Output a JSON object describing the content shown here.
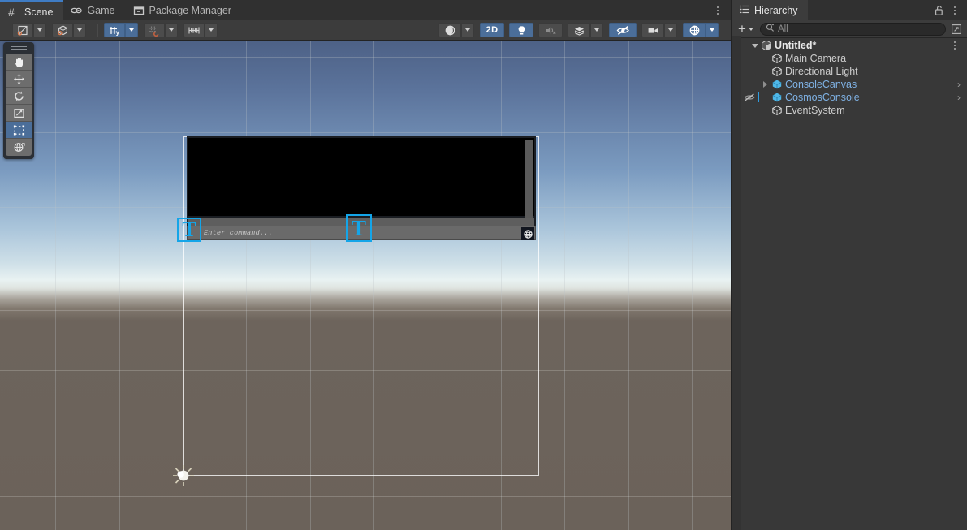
{
  "window": {
    "tabs": [
      {
        "label": "Scene",
        "icon": "grid-hash-icon",
        "active": true
      },
      {
        "label": "Game",
        "icon": "gamepad-icon",
        "active": false
      },
      {
        "label": "Package Manager",
        "icon": "package-icon",
        "active": false
      }
    ],
    "overflow_menu": "more-options"
  },
  "scene_toolbar": {
    "left": [
      {
        "name": "pivot-mode-toggle",
        "icon": "pivot-center-icon",
        "state": "normal"
      },
      {
        "name": "pivot-mode-dropdown",
        "icon": "chevron-down-icon",
        "state": "normal"
      },
      {
        "name": "handle-space-toggle",
        "icon": "cube-global-icon",
        "state": "normal"
      },
      {
        "name": "handle-space-dropdown",
        "icon": "chevron-down-icon",
        "state": "normal"
      },
      {
        "name": "grid-snapping-toggle",
        "icon": "grid-snap-icon",
        "state": "active"
      },
      {
        "name": "grid-snapping-dropdown",
        "icon": "chevron-down-icon",
        "state": "active"
      },
      {
        "name": "grid-visibility-toggle",
        "icon": "grid-magnet-icon",
        "state": "disabled"
      },
      {
        "name": "grid-visibility-dropdown",
        "icon": "chevron-down-icon",
        "state": "disabled"
      },
      {
        "name": "snap-increment-toggle",
        "icon": "ruler-icon",
        "state": "normal"
      },
      {
        "name": "snap-increment-dropdown",
        "icon": "chevron-down-icon",
        "state": "normal"
      }
    ],
    "right": [
      {
        "name": "draw-mode-dropdown",
        "icon": "shaded-sphere-icon",
        "label": "",
        "state": "normal"
      },
      {
        "name": "draw-mode-chevron",
        "icon": "chevron-down-icon",
        "state": "normal"
      },
      {
        "name": "2d-toggle",
        "icon": "",
        "label": "2D",
        "state": "active"
      },
      {
        "name": "scene-lighting-toggle",
        "icon": "lightbulb-icon",
        "state": "active"
      },
      {
        "name": "scene-audio-toggle",
        "icon": "speaker-mute-icon",
        "state": "disabled"
      },
      {
        "name": "scene-fx-dropdown",
        "icon": "layers-fx-icon",
        "state": "normal"
      },
      {
        "name": "scene-fx-chevron",
        "icon": "chevron-down-icon",
        "state": "normal"
      },
      {
        "name": "scene-visibility-toggle",
        "icon": "eye-crossed-icon",
        "state": "active"
      },
      {
        "name": "camera-settings",
        "icon": "camera-icon",
        "state": "normal"
      },
      {
        "name": "camera-settings-chevron",
        "icon": "chevron-down-icon",
        "state": "normal"
      },
      {
        "name": "gizmos-toggle",
        "icon": "gizmo-globe-icon",
        "state": "active"
      },
      {
        "name": "gizmos-chevron",
        "icon": "chevron-down-icon",
        "state": "active"
      }
    ],
    "2d_label": "2D"
  },
  "tools_palette": [
    {
      "name": "hand-tool",
      "icon": "hand-icon",
      "active": false
    },
    {
      "name": "move-tool",
      "icon": "move-arrows-icon",
      "active": false
    },
    {
      "name": "rotate-tool",
      "icon": "rotate-icon",
      "active": false
    },
    {
      "name": "scale-tool",
      "icon": "scale-icon",
      "active": false
    },
    {
      "name": "rect-tool",
      "icon": "rect-transform-icon",
      "active": true
    },
    {
      "name": "transform-tool",
      "icon": "transform-globe-icon",
      "active": false
    }
  ],
  "scene_content": {
    "console_input_placeholder": "Enter command...",
    "submit_icon": "globe-submit-icon",
    "text_gizmo_label": "T",
    "light_gizmo": "directional-light-icon"
  },
  "hierarchy": {
    "title": "Hierarchy",
    "title_icon": "hierarchy-list-icon",
    "lock_icon": "lock-open-icon",
    "menu_icon": "more-options-icon",
    "create_label": "+",
    "search": {
      "placeholder": "All",
      "icon": "search-icon",
      "expand_icon": "expand-window-icon"
    },
    "items": [
      {
        "label": "Untitled*",
        "icon": "unity-scene-icon",
        "indent": 0,
        "twisty": "down",
        "type": "scene",
        "prefab": false,
        "chevron": false,
        "dots": true,
        "visibility_icon": null,
        "selected_bar": false
      },
      {
        "label": "Main Camera",
        "icon": "gameobject-icon",
        "indent": 1,
        "twisty": "none",
        "type": "gameobject",
        "prefab": false,
        "chevron": false,
        "dots": false,
        "visibility_icon": null,
        "selected_bar": false
      },
      {
        "label": "Directional Light",
        "icon": "gameobject-icon",
        "indent": 1,
        "twisty": "none",
        "type": "gameobject",
        "prefab": false,
        "chevron": false,
        "dots": false,
        "visibility_icon": null,
        "selected_bar": false
      },
      {
        "label": "ConsoleCanvas",
        "icon": "prefab-cube-icon",
        "indent": 1,
        "twisty": "right",
        "type": "prefab",
        "prefab": true,
        "chevron": true,
        "dots": false,
        "visibility_icon": null,
        "selected_bar": false
      },
      {
        "label": "CosmosConsole",
        "icon": "prefab-cube-icon",
        "indent": 1,
        "twisty": "none",
        "type": "prefab",
        "prefab": true,
        "chevron": true,
        "dots": false,
        "visibility_icon": "eye-crossed-icon",
        "selected_bar": true
      },
      {
        "label": "EventSystem",
        "icon": "gameobject-icon",
        "indent": 1,
        "twisty": "none",
        "type": "gameobject",
        "prefab": false,
        "chevron": false,
        "dots": false,
        "visibility_icon": null,
        "selected_bar": false
      }
    ]
  },
  "colors": {
    "accent_blue": "#4b6e99",
    "prefab_blue": "#7fb2e5",
    "gizmo_cyan": "#14a5e8",
    "panel_bg": "#383838",
    "toolbar_bg": "#3c3c3c",
    "tabstrip_bg": "#303030"
  }
}
